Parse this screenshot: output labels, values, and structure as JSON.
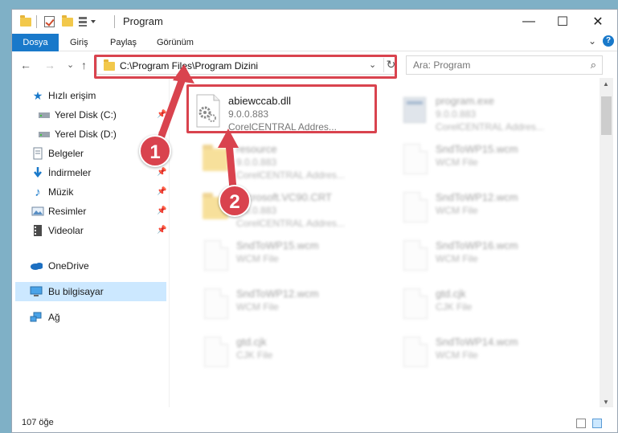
{
  "window": {
    "title": "Program",
    "minimize_glyph": "—",
    "maximize_glyph": "☐",
    "close_glyph": "✕"
  },
  "ribbon": {
    "tabs": [
      {
        "label": "Dosya",
        "active": true
      },
      {
        "label": "Giriş",
        "active": false
      },
      {
        "label": "Paylaş",
        "active": false
      },
      {
        "label": "Görünüm",
        "active": false
      }
    ],
    "expand_glyph": "⌄",
    "help_glyph": "?"
  },
  "nav": {
    "back_glyph": "←",
    "forward_glyph": "→",
    "recent_glyph": "⌄",
    "up_glyph": "↑",
    "address": "C:\\Program Files\\Program Dizini",
    "dropdown_glyph": "⌄",
    "refresh_glyph": "↻",
    "search_placeholder": "Ara: Program",
    "search_glyph": "⌕"
  },
  "sidebar": {
    "items": [
      {
        "label": "Hızlı erişim",
        "icon": "star-icon",
        "pinned": false
      },
      {
        "label": "Yerel Disk (C:)",
        "icon": "drive-icon",
        "pinned": true
      },
      {
        "label": "Yerel Disk (D:)",
        "icon": "drive-icon",
        "pinned": true
      },
      {
        "label": "Belgeler",
        "icon": "documents-icon",
        "pinned": true
      },
      {
        "label": "İndirmeler",
        "icon": "download-icon",
        "pinned": true
      },
      {
        "label": "Müzik",
        "icon": "music-icon",
        "pinned": true
      },
      {
        "label": "Resimler",
        "icon": "pictures-icon",
        "pinned": true
      },
      {
        "label": "Videolar",
        "icon": "videos-icon",
        "pinned": true
      },
      {
        "label": "OneDrive",
        "icon": "cloud-icon",
        "pinned": false
      },
      {
        "label": "Bu bilgisayar",
        "icon": "computer-icon",
        "pinned": false,
        "selected": true
      },
      {
        "label": "Ağ",
        "icon": "network-icon",
        "pinned": false
      }
    ]
  },
  "files": [
    {
      "name": "abiewccab.dll",
      "line1": "9.0.0.883",
      "line2": "CorelCENTRAL Addres...",
      "icon": "dll-gear-icon"
    },
    {
      "name": "program.exe",
      "line1": "9.0.0.883",
      "line2": "CorelCENTRAL Addres...",
      "icon": "exe-icon"
    },
    {
      "name": "resource",
      "line1": "9.0.0.883",
      "line2": "CorelCENTRAL Addres...",
      "icon": "folder-icon"
    },
    {
      "name": "SndToWP15.wcm",
      "line1": "WCM File",
      "line2": "",
      "icon": "document-icon"
    },
    {
      "name": "Microsoft.VC90.CRT",
      "line1": "9.0.0.883",
      "line2": "CorelCENTRAL Addres...",
      "icon": "folder-icon"
    },
    {
      "name": "SndToWP12.wcm",
      "line1": "WCM File",
      "line2": "",
      "icon": "document-icon"
    },
    {
      "name": "SndToWP15.wcm",
      "line1": "WCM File",
      "line2": "",
      "icon": "document-icon"
    },
    {
      "name": "SndToWP16.wcm",
      "line1": "WCM File",
      "line2": "",
      "icon": "document-icon"
    },
    {
      "name": "SndToWP12.wcm",
      "line1": "WCM File",
      "line2": "",
      "icon": "document-icon"
    },
    {
      "name": "gtd.cjk",
      "line1": "CJK File",
      "line2": "",
      "icon": "document-icon"
    },
    {
      "name": "gtd.cjk",
      "line1": "CJK File",
      "line2": "",
      "icon": "document-icon"
    },
    {
      "name": "SndToWP14.wcm",
      "line1": "WCM File",
      "line2": "",
      "icon": "document-icon"
    }
  ],
  "status": {
    "item_count": "107 öğe"
  },
  "annotations": {
    "marker1": "1",
    "marker2": "2",
    "highlight_color": "#d9434e"
  },
  "colors": {
    "accent": "#1979ca",
    "selection": "#cce8ff"
  }
}
